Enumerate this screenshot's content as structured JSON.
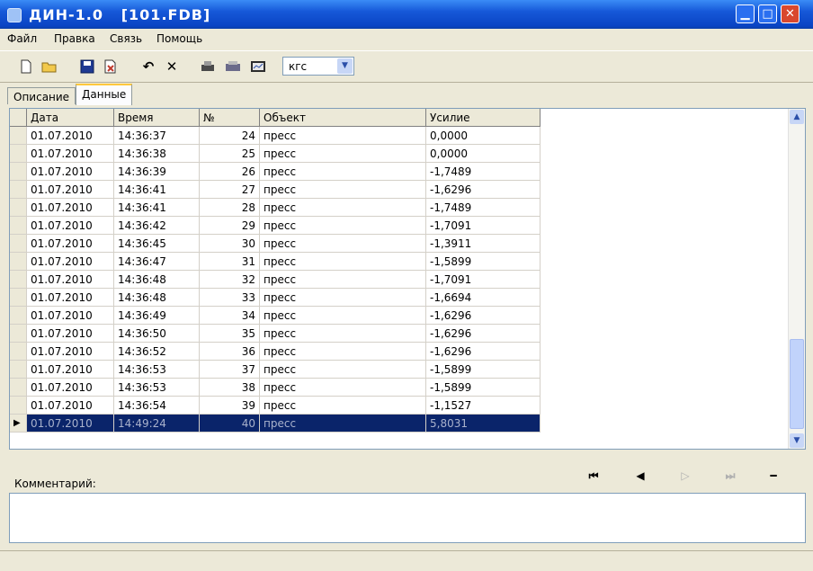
{
  "window": {
    "title": "ДИН-1.0   [101.FDB]"
  },
  "menu": [
    "Файл",
    "Правка",
    "Связь",
    "Помощь"
  ],
  "toolbar": {
    "units_value": "кгс"
  },
  "tabs": [
    "Описание",
    "Данные"
  ],
  "grid": {
    "columns": [
      "Дата",
      "Время",
      "№",
      "Объект",
      "Усилие"
    ],
    "rows": [
      [
        "01.07.2010",
        "14:36:37",
        "24",
        "пресс",
        "0,0000"
      ],
      [
        "01.07.2010",
        "14:36:38",
        "25",
        "пресс",
        "0,0000"
      ],
      [
        "01.07.2010",
        "14:36:39",
        "26",
        "пресс",
        "-1,7489"
      ],
      [
        "01.07.2010",
        "14:36:41",
        "27",
        "пресс",
        "-1,6296"
      ],
      [
        "01.07.2010",
        "14:36:41",
        "28",
        "пресс",
        "-1,7489"
      ],
      [
        "01.07.2010",
        "14:36:42",
        "29",
        "пресс",
        "-1,7091"
      ],
      [
        "01.07.2010",
        "14:36:45",
        "30",
        "пресс",
        "-1,3911"
      ],
      [
        "01.07.2010",
        "14:36:47",
        "31",
        "пресс",
        "-1,5899"
      ],
      [
        "01.07.2010",
        "14:36:48",
        "32",
        "пресс",
        "-1,7091"
      ],
      [
        "01.07.2010",
        "14:36:48",
        "33",
        "пресс",
        "-1,6694"
      ],
      [
        "01.07.2010",
        "14:36:49",
        "34",
        "пресс",
        "-1,6296"
      ],
      [
        "01.07.2010",
        "14:36:50",
        "35",
        "пресс",
        "-1,6296"
      ],
      [
        "01.07.2010",
        "14:36:52",
        "36",
        "пресс",
        "-1,6296"
      ],
      [
        "01.07.2010",
        "14:36:53",
        "37",
        "пресс",
        "-1,5899"
      ],
      [
        "01.07.2010",
        "14:36:53",
        "38",
        "пресс",
        "-1,5899"
      ],
      [
        "01.07.2010",
        "14:36:54",
        "39",
        "пресс",
        "-1,1527"
      ],
      [
        "01.07.2010",
        "14:49:24",
        "40",
        "пресс",
        "5,8031"
      ]
    ],
    "selected_row": 16
  },
  "comment": {
    "label": "Комментарий:"
  }
}
